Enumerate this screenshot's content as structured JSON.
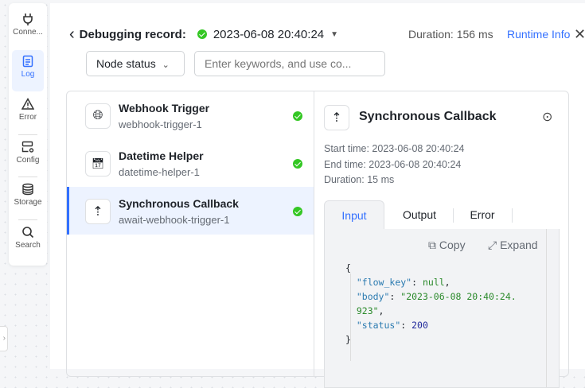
{
  "rail": [
    {
      "label": "Conne...",
      "icon": "plug-icon"
    },
    {
      "label": "Log",
      "icon": "log-icon",
      "active": true
    },
    {
      "label": "Error",
      "icon": "warning-icon"
    },
    {
      "label": "Config",
      "icon": "config-icon"
    },
    {
      "label": "Storage",
      "icon": "database-icon"
    },
    {
      "label": "Search",
      "icon": "search-icon"
    }
  ],
  "header": {
    "title": "Debugging record:",
    "date": "2023-06-08 20:40:24",
    "duration": "Duration: 156 ms",
    "runtime": "Runtime Info"
  },
  "filter": {
    "node_status": "Node status",
    "search_placeholder": "Enter keywords, and use co..."
  },
  "nodes": [
    {
      "name": "Webhook Trigger",
      "id": "webhook-trigger-1"
    },
    {
      "name": "Datetime Helper",
      "id": "datetime-helper-1"
    },
    {
      "name": "Synchronous Callback",
      "id": "await-webhook-trigger-1"
    }
  ],
  "detail": {
    "title": "Synchronous Callback",
    "start": "Start time: 2023-06-08 20:40:24",
    "end": "End time: 2023-06-08 20:40:24",
    "duration": "Duration: 15 ms",
    "tabs": [
      "Input",
      "Output",
      "Error"
    ],
    "copy": "Copy",
    "expand": "Expand"
  }
}
